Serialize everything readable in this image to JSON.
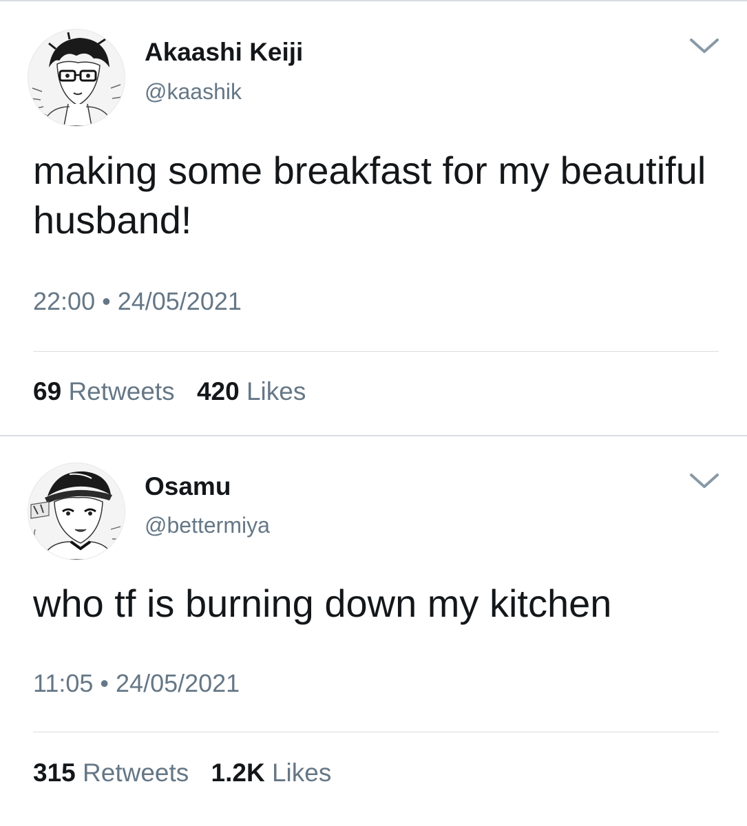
{
  "tweets": [
    {
      "display_name": "Akaashi Keiji",
      "handle": "@kaashik",
      "avatar_icon": "manga-avatar-glasses",
      "text": "making some breakfast for my beautiful husband!",
      "time": "22:00",
      "separator": "•",
      "date": "24/05/2021",
      "retweets_count": "69",
      "retweets_label": "Retweets",
      "likes_count": "420",
      "likes_label": "Likes",
      "menu_icon": "chevron-down-icon"
    },
    {
      "display_name": "Osamu",
      "handle": "@bettermiya",
      "avatar_icon": "manga-avatar-cap",
      "text": "who tf is burning down my kitchen",
      "time": "11:05",
      "separator": "•",
      "date": "24/05/2021",
      "retweets_count": "315",
      "retweets_label": "Retweets",
      "likes_count": "1.2K",
      "likes_label": "Likes",
      "menu_icon": "chevron-down-icon"
    }
  ],
  "colors": {
    "text_primary": "#14171a",
    "text_secondary": "#657786",
    "divider": "#d9dde1",
    "background": "#ffffff"
  }
}
